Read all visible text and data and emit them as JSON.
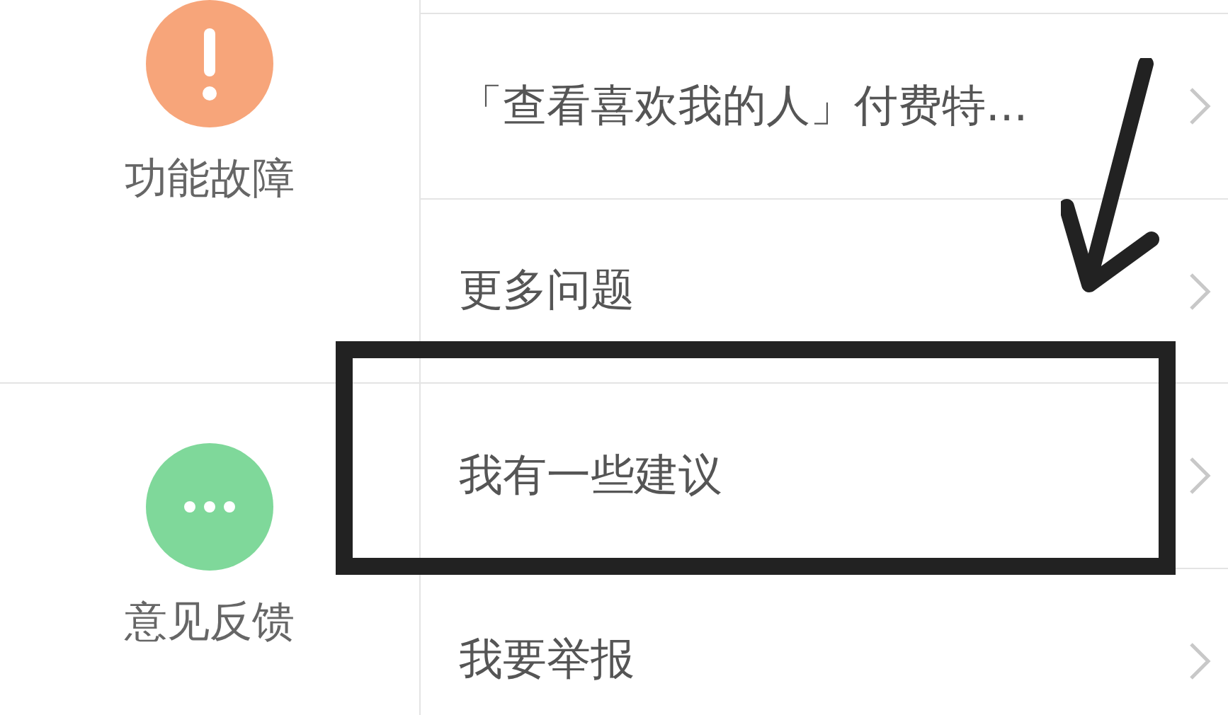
{
  "categories": [
    {
      "label": "功能故障",
      "kind": "alert",
      "color": "#f7a57a",
      "items": [
        {
          "text": "「查看喜欢我的人」付费特...",
          "highlighted": false
        },
        {
          "text": "更多问题",
          "highlighted": false
        }
      ]
    },
    {
      "label": "意见反馈",
      "kind": "more",
      "color": "#7fd89a",
      "items": [
        {
          "text": "我有一些建议",
          "highlighted": true
        },
        {
          "text": "我要举报",
          "highlighted": false
        }
      ]
    }
  ]
}
